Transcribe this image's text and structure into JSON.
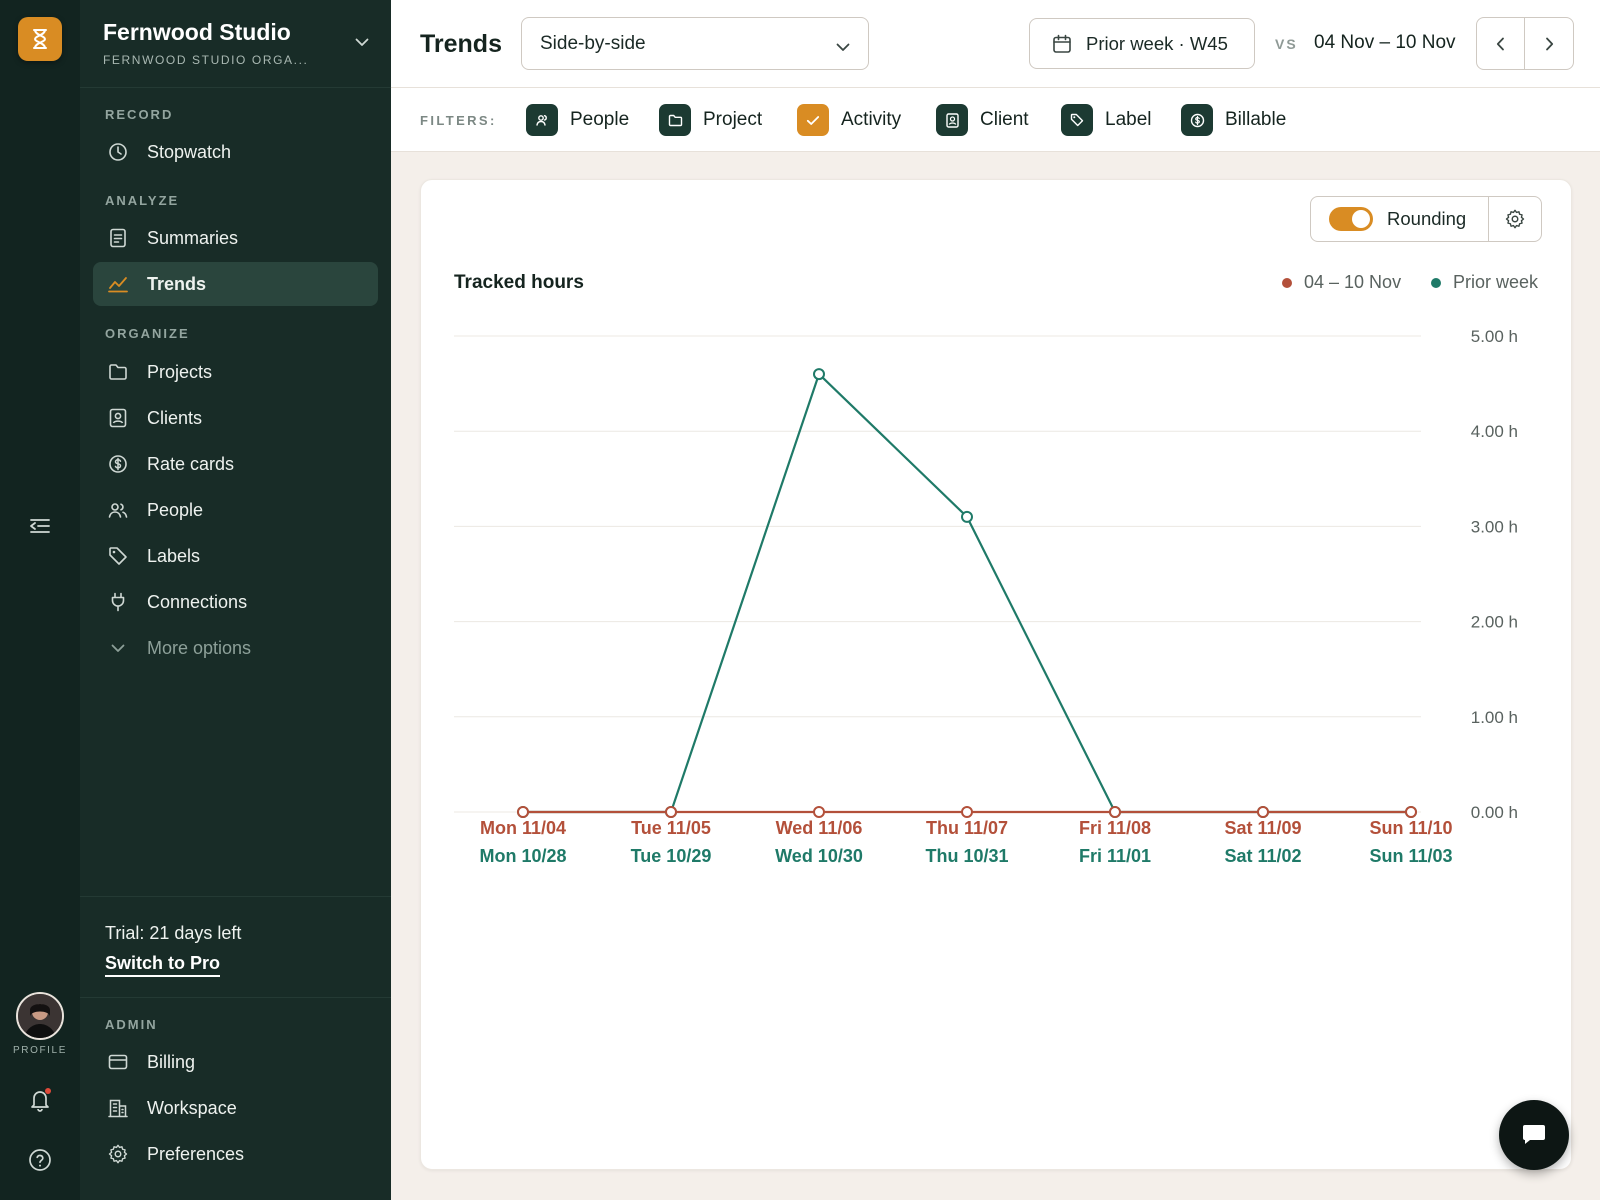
{
  "workspace": {
    "name": "Fernwood Studio",
    "org": "FERNWOOD STUDIO ORGA..."
  },
  "rail": {
    "profile_label": "PROFILE"
  },
  "sidebar": {
    "sections": {
      "record": "RECORD",
      "analyze": "ANALYZE",
      "organize": "ORGANIZE",
      "admin": "ADMIN"
    },
    "items": {
      "stopwatch": "Stopwatch",
      "summaries": "Summaries",
      "trends": "Trends",
      "projects": "Projects",
      "clients": "Clients",
      "rate_cards": "Rate cards",
      "people": "People",
      "labels": "Labels",
      "connections": "Connections",
      "more_options": "More options",
      "billing": "Billing",
      "workspace": "Workspace",
      "preferences": "Preferences"
    },
    "trial": {
      "text": "Trial: 21 days left",
      "link": "Switch to Pro"
    }
  },
  "header": {
    "title": "Trends",
    "view_select": "Side-by-side",
    "compare_period": "Prior week · W45",
    "vs": "VS",
    "current_range": "04 Nov – 10 Nov"
  },
  "filters": {
    "label": "FILTERS:",
    "items": [
      "People",
      "Project",
      "Activity",
      "Client",
      "Label",
      "Billable"
    ],
    "active": "Activity"
  },
  "card": {
    "rounding_label": "Rounding",
    "rounding_on": true
  },
  "colors": {
    "current": "#b3503a",
    "prior": "#1f7a68",
    "accent": "#d98c23"
  },
  "chart_data": {
    "type": "line",
    "title": "Tracked hours",
    "legend_placement": "top-right",
    "y_tick_labels": [
      "0.00 h",
      "1.00 h",
      "2.00 h",
      "3.00 h",
      "4.00 h",
      "5.00 h"
    ],
    "ylim": [
      0,
      5
    ],
    "grid": true,
    "categories_current": [
      "Mon 11/04",
      "Tue 11/05",
      "Wed 11/06",
      "Thu 11/07",
      "Fri 11/08",
      "Sat 11/09",
      "Sun 11/10"
    ],
    "categories_prior": [
      "Mon 10/28",
      "Tue 10/29",
      "Wed 10/30",
      "Thu 10/31",
      "Fri 11/01",
      "Sat 11/02",
      "Sun 11/03"
    ],
    "series": [
      {
        "name": "04 – 10 Nov",
        "values": [
          0,
          0,
          0,
          0,
          0,
          0,
          0
        ]
      },
      {
        "name": "Prior week",
        "values": [
          0,
          0,
          4.6,
          3.1,
          0,
          0,
          0
        ]
      }
    ]
  }
}
